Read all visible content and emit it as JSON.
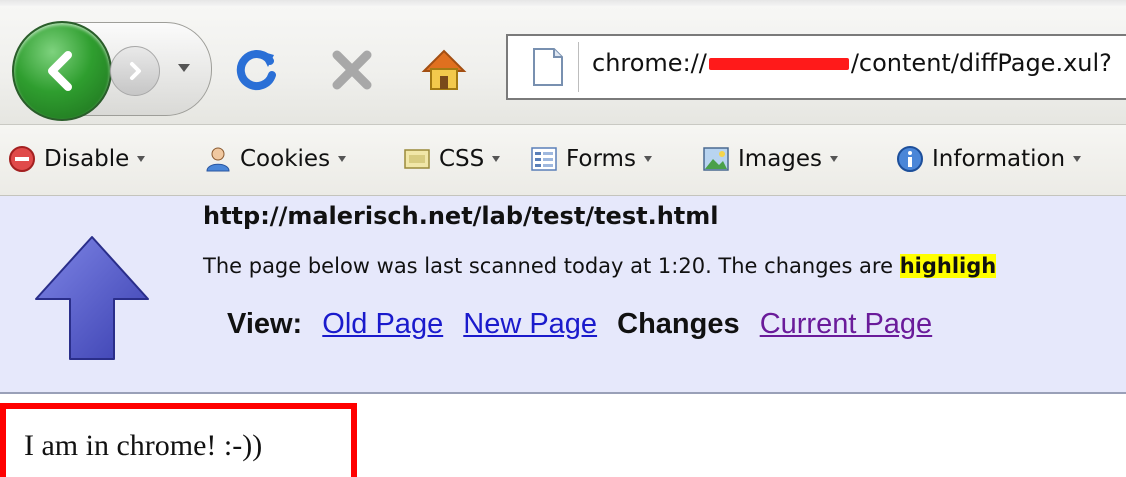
{
  "navigation": {
    "url_prefix": "chrome://",
    "url_suffix": "/content/diffPage.xul?"
  },
  "dev_toolbar": {
    "items": [
      {
        "label": "Disable",
        "icon": "disable-icon"
      },
      {
        "label": "Cookies",
        "icon": "cookies-icon"
      },
      {
        "label": "CSS",
        "icon": "css-icon"
      },
      {
        "label": "Forms",
        "icon": "forms-icon"
      },
      {
        "label": "Images",
        "icon": "images-icon"
      },
      {
        "label": "Information",
        "icon": "information-icon"
      }
    ]
  },
  "scanner": {
    "url": "http://malerisch.net/lab/test/test.html",
    "description_prefix": "The page below was last scanned today at 1:20. The changes are ",
    "description_highlight": "highligh",
    "view_label": "View:",
    "links": {
      "old_page": "Old Page",
      "new_page": "New Page",
      "changes": "Changes",
      "current_page": "Current Page"
    }
  },
  "content": {
    "message": "I am in chrome! :-))"
  },
  "colors": {
    "panel_background": "#e6e8fb",
    "highlight": "#ffff00",
    "annotation_border": "#ff0000",
    "redaction": "#ff1a1a"
  }
}
